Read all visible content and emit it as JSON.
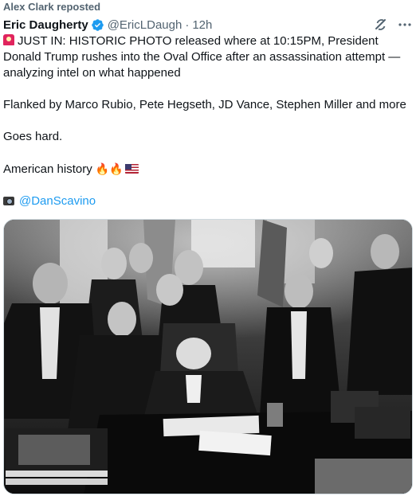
{
  "repost": {
    "text": "Alex Clark reposted"
  },
  "author": {
    "name": "Eric Daugherty",
    "handle": "@EricLDaugh",
    "separator": "·",
    "time": "12h",
    "verified_color": "#1d9bf0"
  },
  "icons": {
    "verified": "verified-badge-icon",
    "grok": "grok-icon",
    "more": "more-icon"
  },
  "tweet": {
    "line1": "JUST IN: HISTORIC PHOTO released where at 10:15PM, President Donald Trump rushes into the Oval Office after an assassination attempt — analyzing intel on what happened",
    "line2": "Flanked by Marco Rubio, Pete Hegseth, JD Vance, Stephen Miller and more",
    "line3": "Goes hard.",
    "line4": "American history",
    "mention": "@DanScavino"
  },
  "media": {
    "kind": "photo",
    "tone": "black-and-white",
    "subject": "Oval Office"
  },
  "colors": {
    "link": "#1d9bf0",
    "muted": "#536471",
    "text": "#0f1419"
  }
}
